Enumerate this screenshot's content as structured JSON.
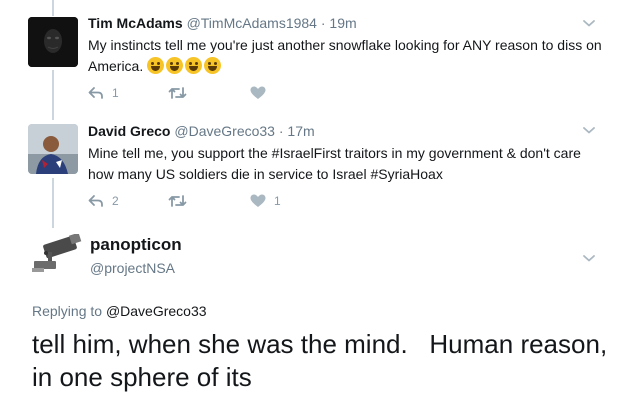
{
  "colors": {
    "text": "#14171a",
    "secondary": "#657786",
    "icon": "#8899a6",
    "thread_line": "#ccd6dd"
  },
  "tweets": [
    {
      "fullname": "Tim McAdams",
      "handle": "@TimMcAdams1984",
      "separator": "·",
      "time": "19m",
      "text_before_emoji": "My instincts tell me you're just another snowflake looking for ANY reason to diss on America.",
      "emojis": [
        "rofl-emoji",
        "joy-emoji",
        "grinning-emoji",
        "grinning-emoji"
      ],
      "actions": {
        "reply_count": "1",
        "retweet_count": "",
        "like_count": ""
      }
    },
    {
      "fullname": "David Greco",
      "handle": "@DaveGreco33",
      "separator": "·",
      "time": "17m",
      "text_1": "Mine tell me, you support the ",
      "hashtag_1": "#IsraelFirst",
      "text_2": " traitors in my government & don't care how many US soldiers die in service to Israel ",
      "hashtag_2": "#SyriaHoax",
      "actions": {
        "reply_count": "2",
        "retweet_count": "",
        "like_count": "1"
      }
    }
  ],
  "main_tweet": {
    "fullname": "panopticon",
    "handle": "@projectNSA",
    "replying_prefix": "Replying to",
    "replying_to": "@DaveGreco33",
    "text": "tell him, when she was the mind.   Human reason, in one sphere of its"
  },
  "icons": {
    "caret": "chevron-down-icon",
    "reply": "reply-icon",
    "retweet": "retweet-icon",
    "like": "heart-icon",
    "main_avatar": "security-camera-icon"
  }
}
